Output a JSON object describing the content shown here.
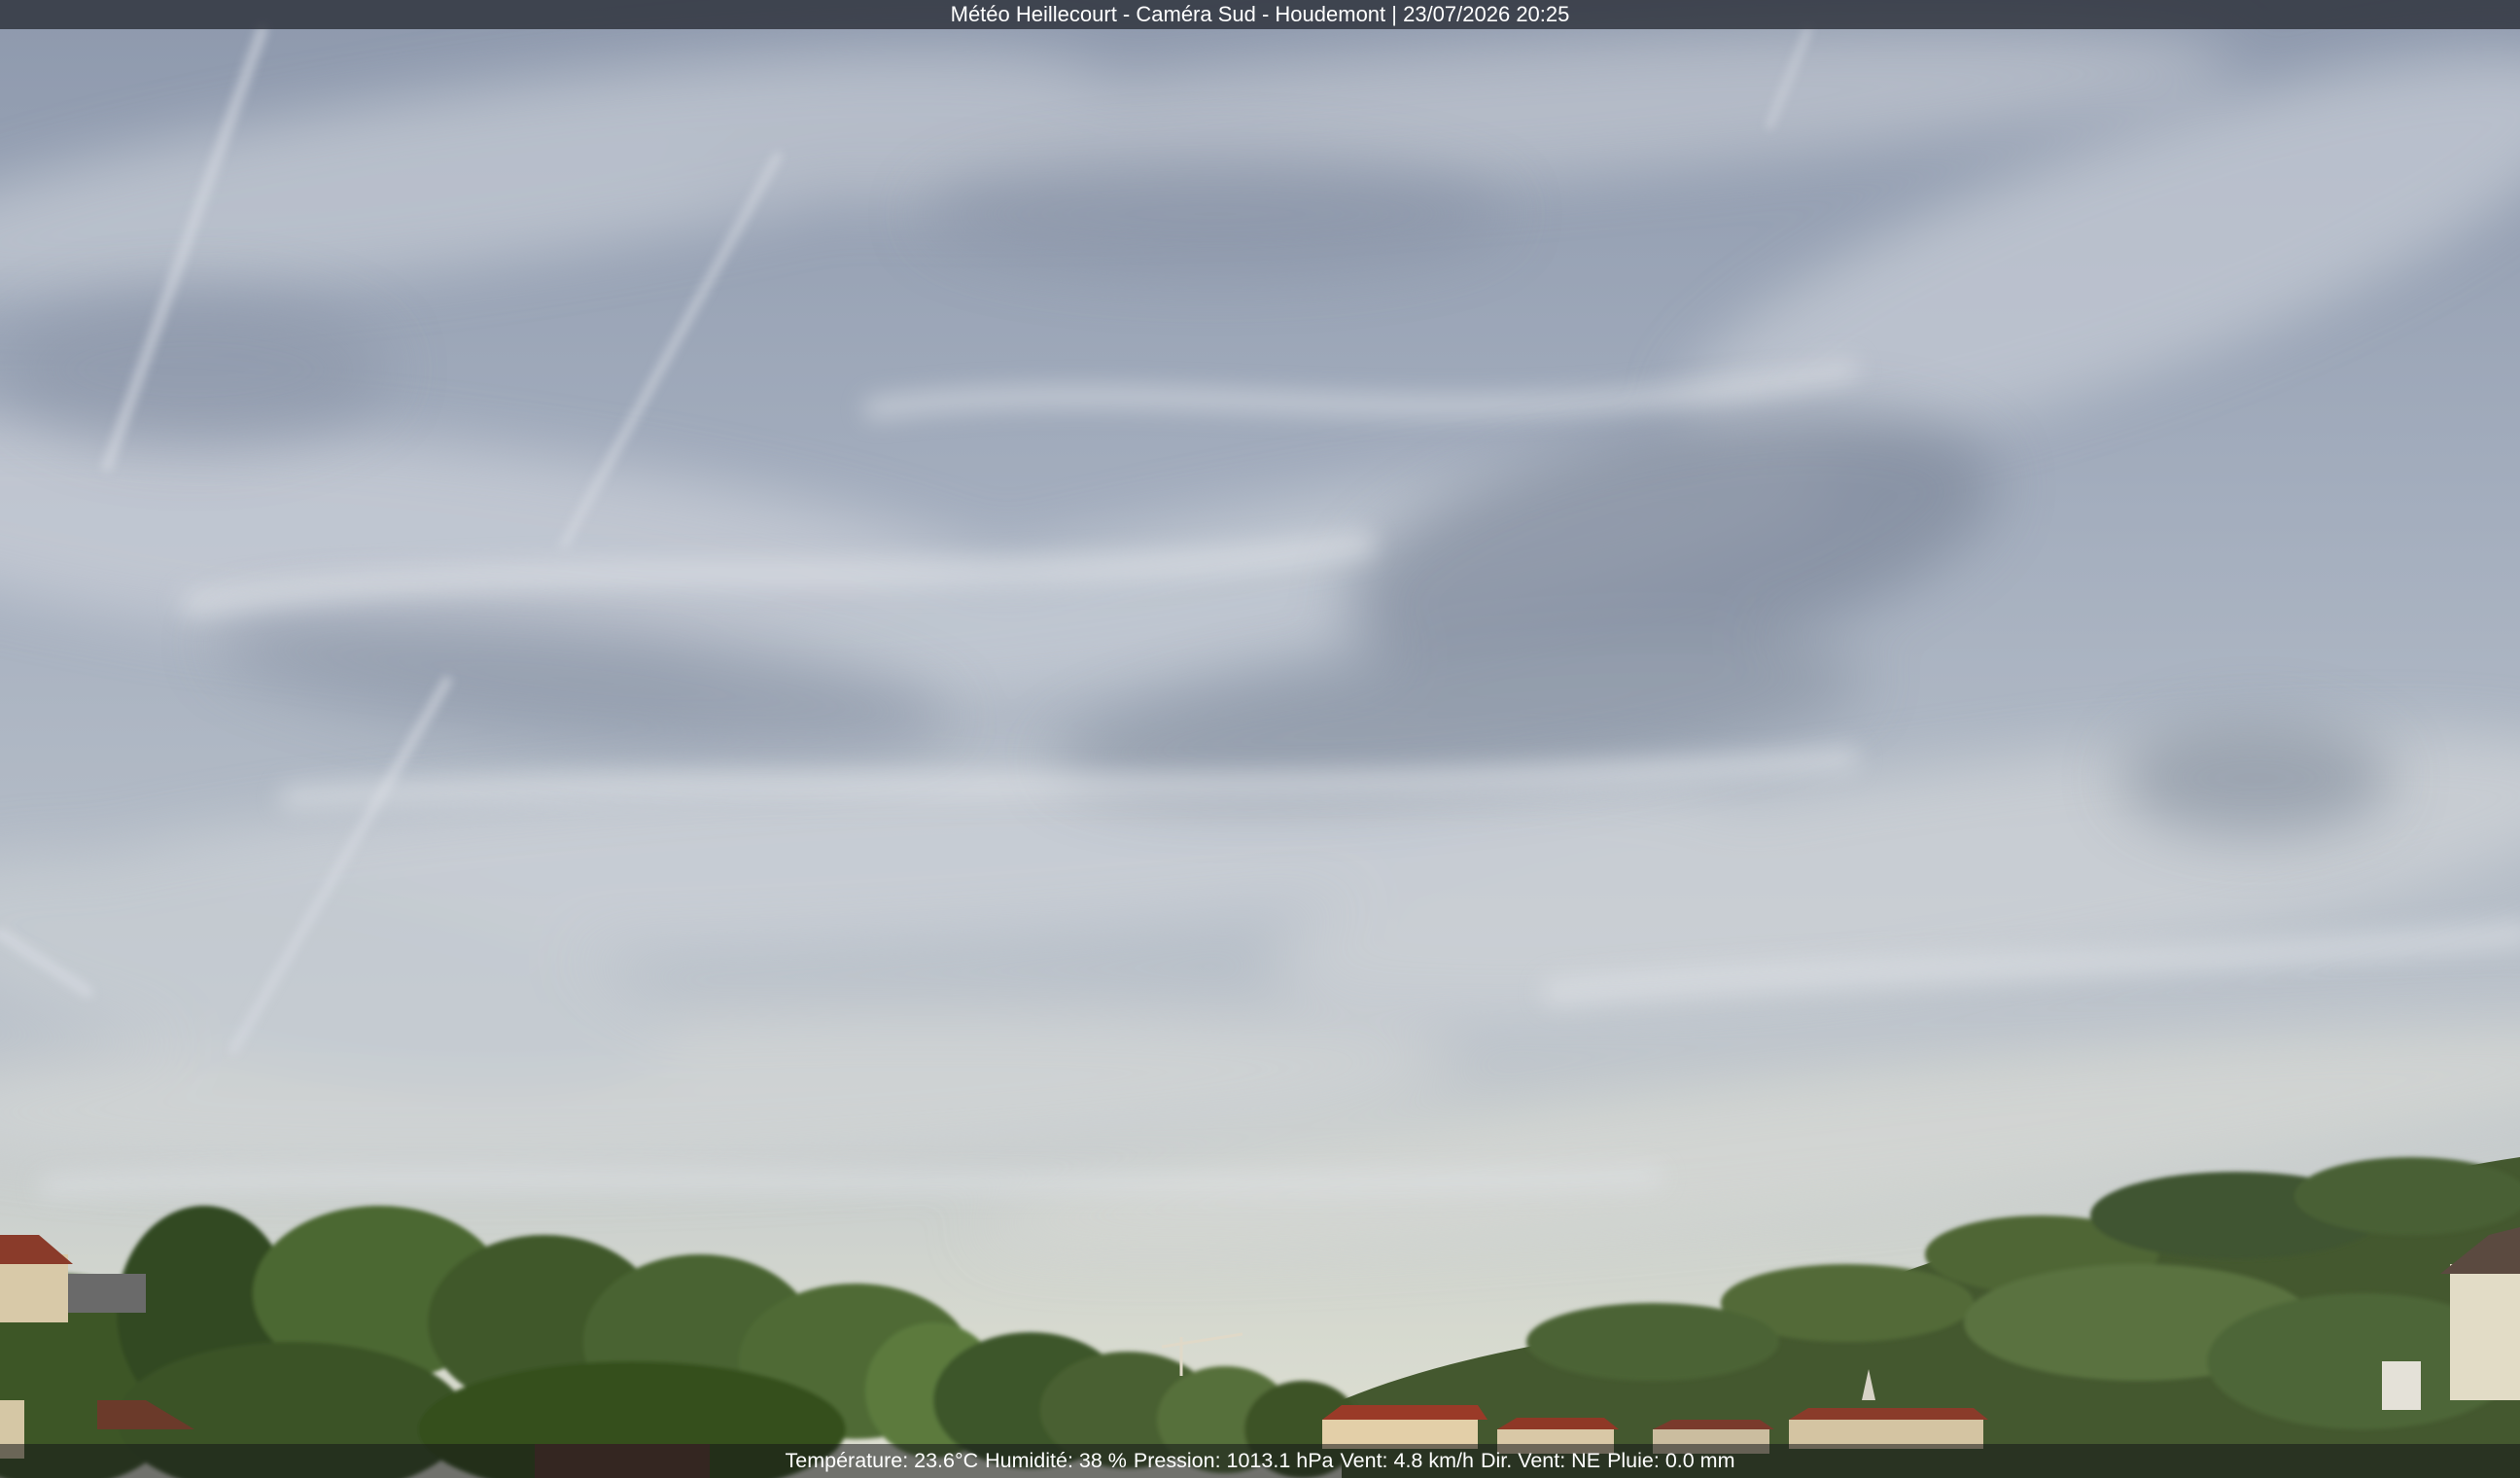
{
  "overlay": {
    "title": "Météo Heillecourt - Caméra Sud - Houdemont | 23/07/2026 20:25"
  },
  "weather": {
    "temperature": "Température: 23.6°C",
    "humidity": "Humidité: 38 %",
    "pressure": "Pression: 1013.1 hPa",
    "wind_speed": "Vent: 4.8 km/h",
    "wind_direction": "Dir. Vent: NE",
    "rain": "Pluie: 0.0 mm"
  },
  "colors": {
    "sky_top": "#8f9aae",
    "sky_mid": "#a9b3c2",
    "sky_horizon": "#d9dccf",
    "cloud": "#c9ced8",
    "cloud_dark": "#7f8a9c",
    "tree_dark": "#2f4a22",
    "tree_light": "#5f7a3c",
    "roof": "#8a3b2a",
    "overlay_bg": "#2b2e33"
  }
}
